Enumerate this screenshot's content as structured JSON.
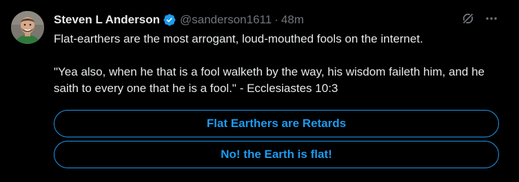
{
  "author": {
    "display_name": "Steven L Anderson",
    "handle": "@sanderson1611",
    "separator": "·",
    "time": "48m"
  },
  "tweet": {
    "text": "Flat-earthers are the most arrogant, loud-mouthed fools on the internet.\n\n\"Yea also, when he that is a fool walketh by the way, his wisdom faileth him, and he saith to every one that he is a fool.\" - Ecclesiastes 10:3"
  },
  "poll": {
    "options": [
      {
        "label": "Flat Earthers are Retards"
      },
      {
        "label": "No! the Earth is flat!"
      }
    ]
  },
  "icons": {
    "verified": "verified-badge-icon",
    "grok": "grok-icon",
    "more": "more-icon"
  },
  "colors": {
    "background": "#000000",
    "primary_text": "#e7e9ea",
    "secondary_text": "#71767b",
    "accent": "#1d9bf0"
  }
}
